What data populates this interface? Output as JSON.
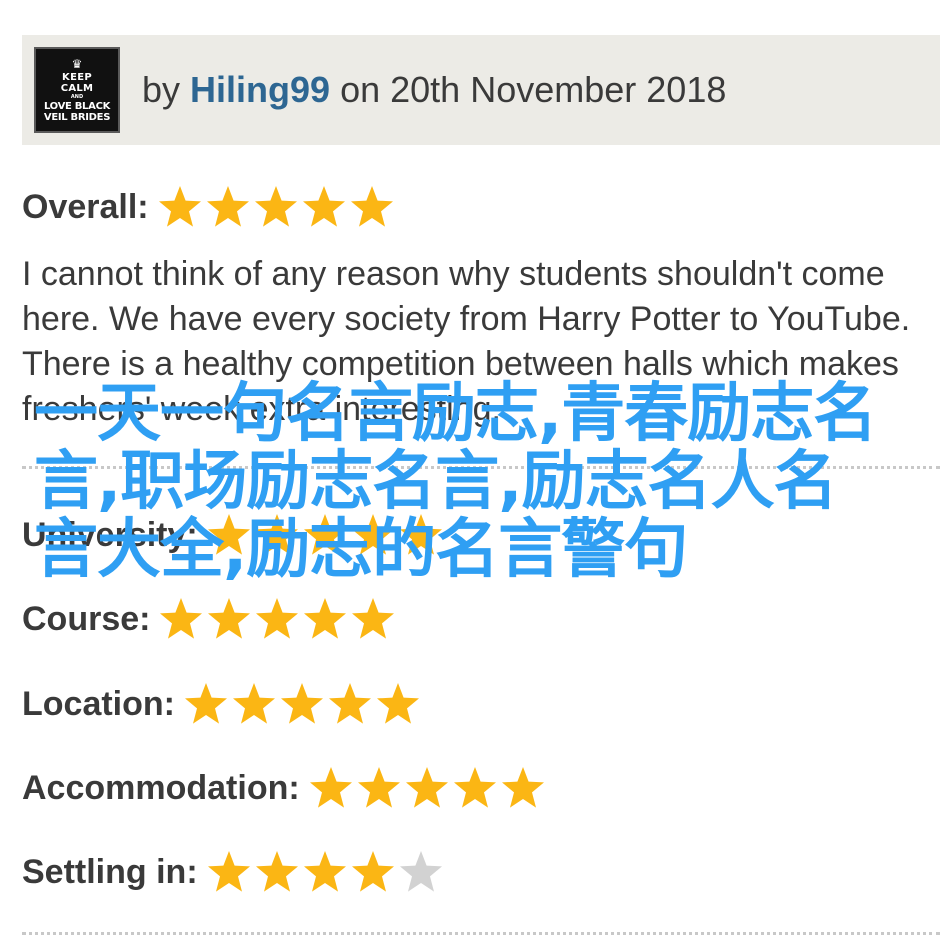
{
  "review": {
    "avatar_text": [
      "KEEP",
      "CALM",
      "AND",
      "LOVE BLACK",
      "VEIL BRIDES"
    ],
    "by_prefix": "by",
    "author": "Hiling99",
    "date_text": "on 20th November 2018",
    "overall_label": "Overall:",
    "overall_stars": 5,
    "body": "I cannot think of any reason why students shouldn't come here. We have every society from Harry Potter to YouTube. There is a healthy competition between halls which makes freshers' week extra interesting."
  },
  "ratings": [
    {
      "label": "University:",
      "stars": 5
    },
    {
      "label": "Course:",
      "stars": 5
    },
    {
      "label": "Location:",
      "stars": 5
    },
    {
      "label": "Accommodation:",
      "stars": 5
    },
    {
      "label": "Settling in:",
      "stars": 4
    }
  ],
  "overlay": {
    "text": "一天一句名言励志,青春励志名言,职场励志名言,励志名人名言大全,励志的名言警句"
  },
  "colors": {
    "star_filled": "#fbb614",
    "star_empty": "#d2d2d2",
    "author_link": "#2d6692",
    "overlay_text": "#2f9ff3",
    "header_bg": "#ecebe6"
  },
  "icons": {
    "star_filled": "star-filled-icon",
    "star_empty": "star-empty-icon"
  }
}
